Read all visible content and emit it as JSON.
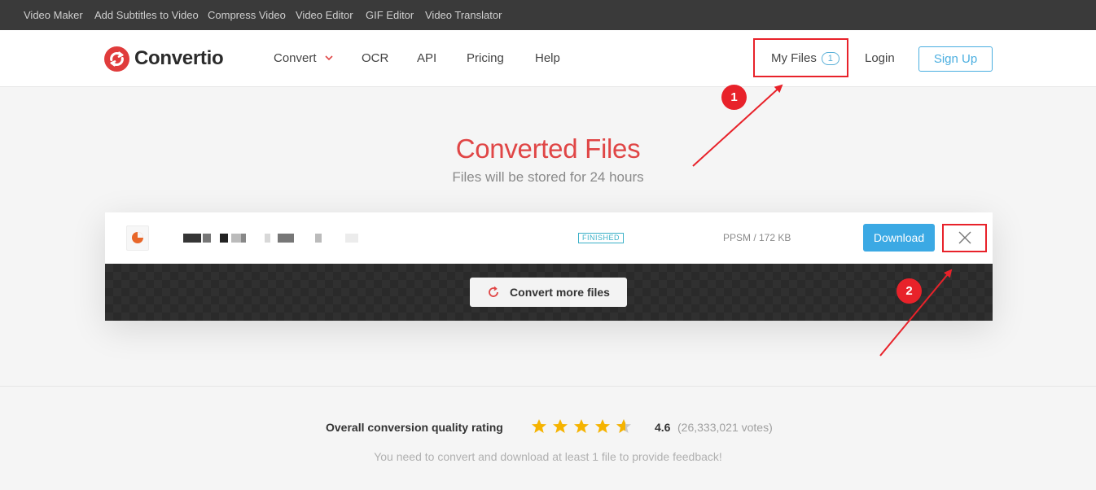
{
  "topbar": {
    "links": [
      "Video Maker",
      "Add Subtitles to Video",
      "Compress Video",
      "Video Editor",
      "GIF Editor",
      "Video Translator"
    ]
  },
  "header": {
    "logo_text": "Convertio",
    "nav": [
      "Convert",
      "OCR",
      "API",
      "Pricing",
      "Help"
    ],
    "my_files_label": "My Files",
    "my_files_count": "1",
    "login_label": "Login",
    "signup_label": "Sign Up"
  },
  "hero": {
    "title": "Converted Files",
    "subtitle": "Files will be stored for 24 hours"
  },
  "file": {
    "status": "FINISHED",
    "meta": "PPSM / 172 KB",
    "download_label": "Download"
  },
  "convert_more_label": "Convert more files",
  "rating": {
    "label": "Overall conversion quality rating",
    "score": "4.6",
    "votes": "(26,333,021 votes)",
    "stars_value": 4.6,
    "feedback": "You need to convert and download at least 1 file to provide feedback!"
  },
  "annotations": {
    "step1": "1",
    "step2": "2"
  },
  "colors": {
    "accent_red": "#e04646",
    "brand_blue": "#3ba9e4",
    "annotation_red": "#e8222a",
    "star": "#f5b301"
  }
}
